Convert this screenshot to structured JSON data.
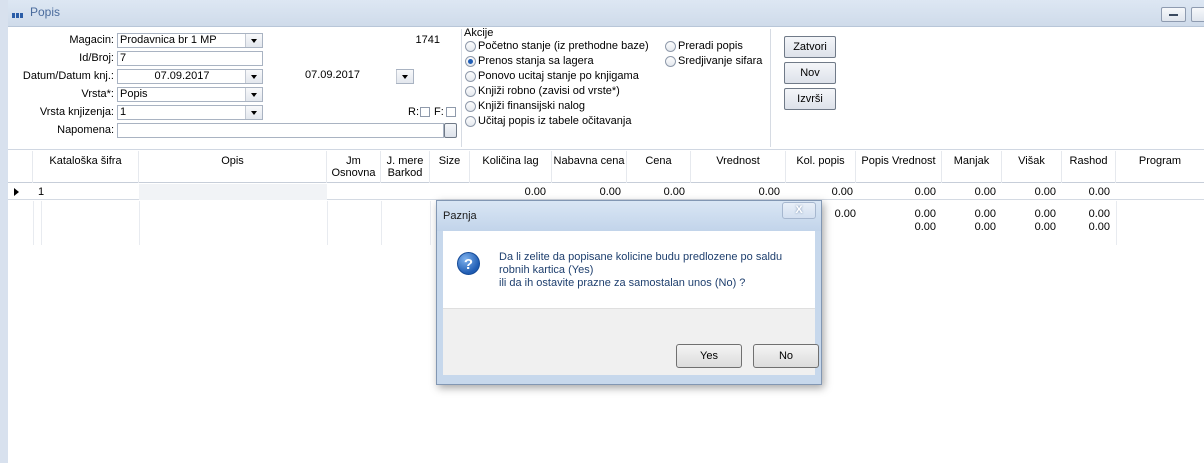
{
  "window": {
    "title": "Popis"
  },
  "form": {
    "magacin_label": "Magacin:",
    "magacin_value": "Prodavnica br 1 MP",
    "magacin_code": "1741",
    "id_label": "Id/Broj:",
    "id_value": "7",
    "datum_label": "Datum/Datum knj.:",
    "datum_value": "07.09.2017",
    "datum_knj_value": "07.09.2017",
    "vrsta_label": "Vrsta*:",
    "vrsta_value": "Popis",
    "vrsta_knj_label": "Vrsta knjizenja:",
    "vrsta_knj_value": "1",
    "r_label": "R:",
    "f_label": "F:",
    "napomena_label": "Napomena:",
    "napomena_value": ""
  },
  "akcije": {
    "title": "Akcije",
    "options": [
      "Početno stanje (iz prethodne baze)",
      "Prenos stanja sa lagera",
      "Ponovo ucitaj stanje po knjigama",
      "Knjiži robno (zavisi od vrste*)",
      "Knjiži finansijski nalog",
      "Učitaj popis iz tabele očitavanja",
      "Preradi popis",
      "Sredjivanje sifara"
    ],
    "selected": "Prenos stanja sa lagera"
  },
  "buttons": {
    "zatvori": "Zatvori",
    "nov": "Nov",
    "izvrsi": "Izvrši"
  },
  "grid": {
    "headers": {
      "kataloska": "Kataloška šifra",
      "opis": "Opis",
      "jm1": "Jm",
      "jm2": "Osnovna",
      "jmere1": "J. mere",
      "jmere2": "Barkod",
      "size": "Size",
      "kolicina": "Količina lag",
      "nabavna": "Nabavna cena",
      "cena": "Cena",
      "vrednost": "Vrednost",
      "kolpopis": "Kol. popis",
      "popisvr": "Popis Vrednost",
      "manjak": "Manjak",
      "visak": "Višak",
      "rashod": "Rashod",
      "program": "Program"
    },
    "row1": {
      "no": "1",
      "kolicina": "0.00",
      "nabavna": "0.00",
      "cena": "0.00",
      "vrednost": "0.00",
      "kolpopis": "0.00",
      "popisvr": "0.00",
      "manjak": "0.00",
      "visak": "0.00",
      "rashod": "0.00"
    },
    "total1": {
      "kolpopis": "0.00",
      "popisvr": "0.00",
      "manjak": "0.00",
      "visak": "0.00",
      "rashod": "0.00"
    },
    "total2": {
      "popisvr": "0.00",
      "manjak": "0.00",
      "visak": "0.00",
      "rashod": "0.00"
    }
  },
  "dialog": {
    "title": "Paznja",
    "close": "X",
    "line1": "Da li zelite da popisane kolicine budu predlozene po saldu",
    "line2": "robnih kartica (Yes)",
    "line3": "ili da ih ostavite prazne za samostalan unos (No) ?",
    "yes": "Yes",
    "no": "No"
  }
}
